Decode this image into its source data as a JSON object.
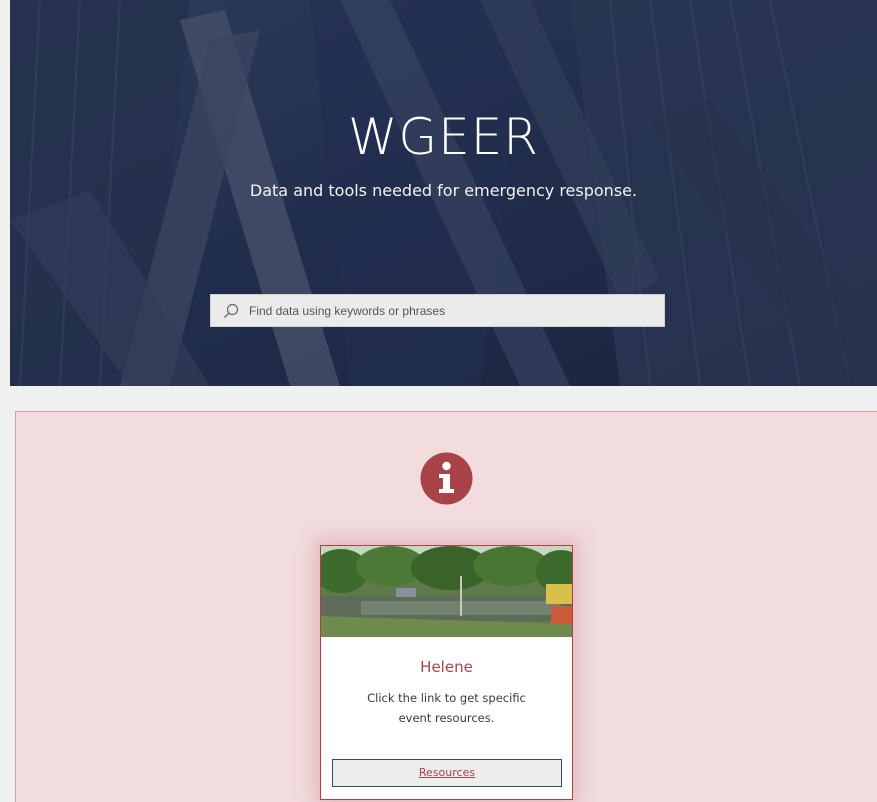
{
  "hero": {
    "title": "WGEER",
    "subtitle": "Data and tools needed for emergency response."
  },
  "search": {
    "icon": "search-icon",
    "placeholder": "Find data using keywords or phrases",
    "value": ""
  },
  "alert": {
    "icon": "info-icon",
    "accent_color": "#a8434a",
    "background_color": "#f2dcde"
  },
  "event_card": {
    "title": "Helene",
    "description": "Click the link to get specific event resources.",
    "button_label": "Resources"
  }
}
